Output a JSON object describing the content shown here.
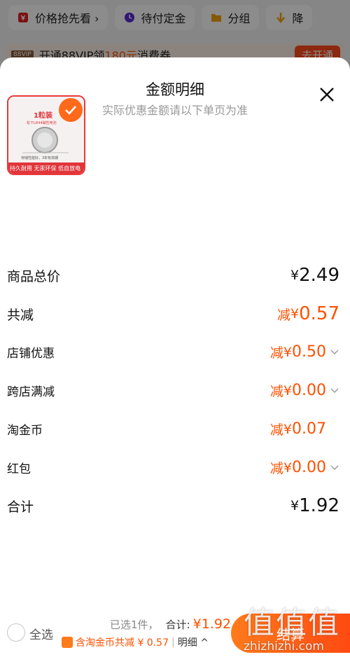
{
  "background": {
    "chips": [
      {
        "label": "价格抢先看 ›",
        "icon": "price-tag-icon"
      },
      {
        "label": "待付定金",
        "icon": "clock-icon"
      },
      {
        "label": "分组",
        "icon": "folder-icon"
      },
      {
        "label": "降",
        "icon": "down-arrow-icon"
      }
    ],
    "vip": {
      "tag": "88VIP",
      "text_pre": "开通88VIP领",
      "amount": "180元",
      "text_post": "消费券",
      "button": "去开通"
    }
  },
  "sheet": {
    "title": "金额明细",
    "subtitle": "实际优惠金额请以下单页为准",
    "product": {
      "badge": "1粒装",
      "model": "松下LR44碱性电池",
      "line1": "存储性能好，3年有效期",
      "footer": "持久耐用 无汞环保 低自放电"
    },
    "rows": [
      {
        "label": "商品总价",
        "prefix": "",
        "symbol": "¥",
        "amount": "2.49"
      },
      {
        "label": "共减",
        "prefix": "减",
        "symbol": "¥",
        "amount": "0.57"
      },
      {
        "label": "店铺优惠",
        "prefix": "减",
        "symbol": "¥",
        "amount": "0.50"
      },
      {
        "label": "跨店满减",
        "prefix": "减",
        "symbol": "¥",
        "amount": "0.00"
      },
      {
        "label": "淘金币",
        "prefix": "减",
        "symbol": "¥",
        "amount": "0.07"
      },
      {
        "label": "红包",
        "prefix": "减",
        "symbol": "¥",
        "amount": "0.00"
      },
      {
        "label": "合计",
        "prefix": "",
        "symbol": "¥",
        "amount": "1.92"
      }
    ]
  },
  "bottom": {
    "select_all": "全选",
    "selected": "已选1件，",
    "total_label": "合计:",
    "total_amount": "¥1.92",
    "coin_text": "含淘金币共减 ¥ 0.57",
    "sep": "|",
    "detail": "明细 ^",
    "pay": "结算"
  },
  "watermark": {
    "line1": "值值值",
    "line2": "zhizhizhi.com"
  },
  "colors": {
    "accent": "#ff5000",
    "button": "#ff4a12",
    "muted": "#999999"
  }
}
